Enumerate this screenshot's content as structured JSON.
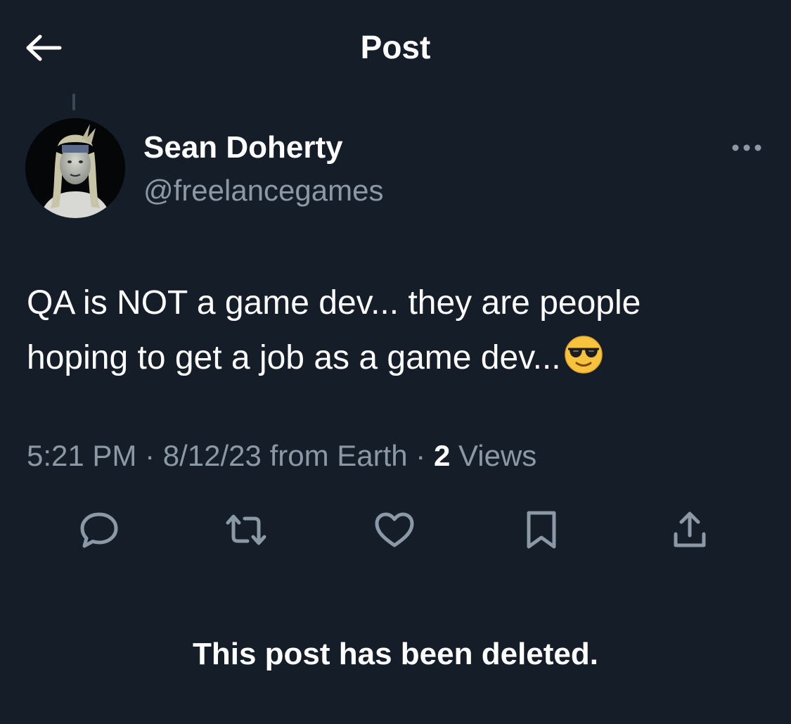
{
  "header": {
    "title": "Post",
    "back_icon": "arrow-left-icon"
  },
  "post": {
    "author": {
      "name": "Sean Doherty",
      "handle": "@freelancegames"
    },
    "text_line1": "QA is NOT a game dev... they are people",
    "text_line2": "hoping to get a job as a game dev...",
    "emoji": "smiling-face-with-sunglasses",
    "meta": {
      "time": "5:21 PM",
      "separator": "·",
      "date_source": "8/12/23 from Earth",
      "views_count": "2",
      "views_label": "Views"
    },
    "actions": [
      "reply-icon",
      "repost-icon",
      "like-icon",
      "bookmark-icon",
      "share-icon"
    ]
  },
  "deleted_notice": "This post has been deleted.",
  "colors": {
    "background": "#151d28",
    "primary_text": "#ffffff",
    "secondary_text": "#8b98a5",
    "icon": "#8b98a5"
  }
}
